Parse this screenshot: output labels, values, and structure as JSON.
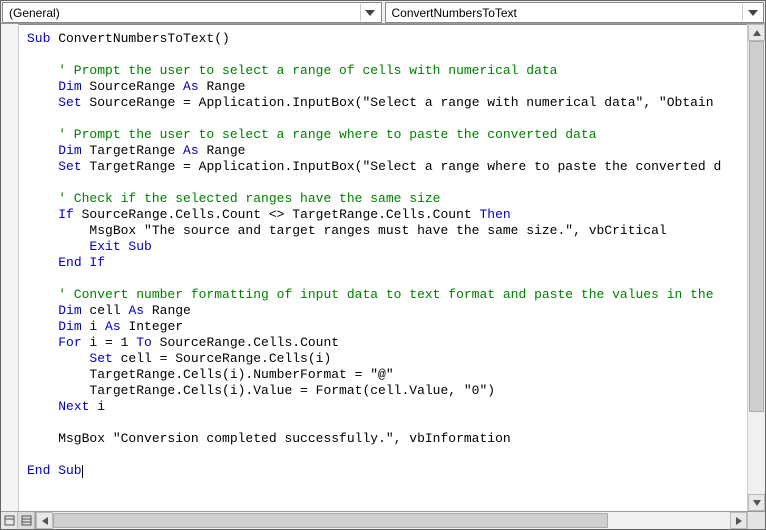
{
  "dropdowns": {
    "object": "(General)",
    "procedure": "ConvertNumbersToText"
  },
  "code": {
    "l01_a": "Sub",
    "l01_b": " ConvertNumbersToText()",
    "l02": "",
    "l03": "    ' Prompt the user to select a range of cells with numerical data",
    "l04_a": "    ",
    "l04_b": "Dim",
    "l04_c": " SourceRange ",
    "l04_d": "As",
    "l04_e": " Range",
    "l05_a": "    ",
    "l05_b": "Set",
    "l05_c": " SourceRange = Application.InputBox(\"Select a range with numerical data\", \"Obtain ",
    "l06": "",
    "l07": "    ' Prompt the user to select a range where to paste the converted data",
    "l08_a": "    ",
    "l08_b": "Dim",
    "l08_c": " TargetRange ",
    "l08_d": "As",
    "l08_e": " Range",
    "l09_a": "    ",
    "l09_b": "Set",
    "l09_c": " TargetRange = Application.InputBox(\"Select a range where to paste the converted d",
    "l10": "",
    "l11": "    ' Check if the selected ranges have the same size",
    "l12_a": "    ",
    "l12_b": "If",
    "l12_c": " SourceRange.Cells.Count <> TargetRange.Cells.Count ",
    "l12_d": "Then",
    "l13": "        MsgBox \"The source and target ranges must have the same size.\", vbCritical",
    "l14_a": "        ",
    "l14_b": "Exit Sub",
    "l15_a": "    ",
    "l15_b": "End If",
    "l16": "",
    "l17": "    ' Convert number formatting of input data to text format and paste the values in the ",
    "l18_a": "    ",
    "l18_b": "Dim",
    "l18_c": " cell ",
    "l18_d": "As",
    "l18_e": " Range",
    "l19_a": "    ",
    "l19_b": "Dim",
    "l19_c": " i ",
    "l19_d": "As",
    "l19_e": " Integer",
    "l20_a": "    ",
    "l20_b": "For",
    "l20_c": " i = 1 ",
    "l20_d": "To",
    "l20_e": " SourceRange.Cells.Count",
    "l21_a": "        ",
    "l21_b": "Set",
    "l21_c": " cell = SourceRange.Cells(i)",
    "l22": "        TargetRange.Cells(i).NumberFormat = \"@\"",
    "l23": "        TargetRange.Cells(i).Value = Format(cell.Value, \"0\")",
    "l24_a": "    ",
    "l24_b": "Next",
    "l24_c": " i",
    "l25": "",
    "l26": "    MsgBox \"Conversion completed successfully.\", vbInformation",
    "l27": "",
    "l28": "End Sub"
  }
}
